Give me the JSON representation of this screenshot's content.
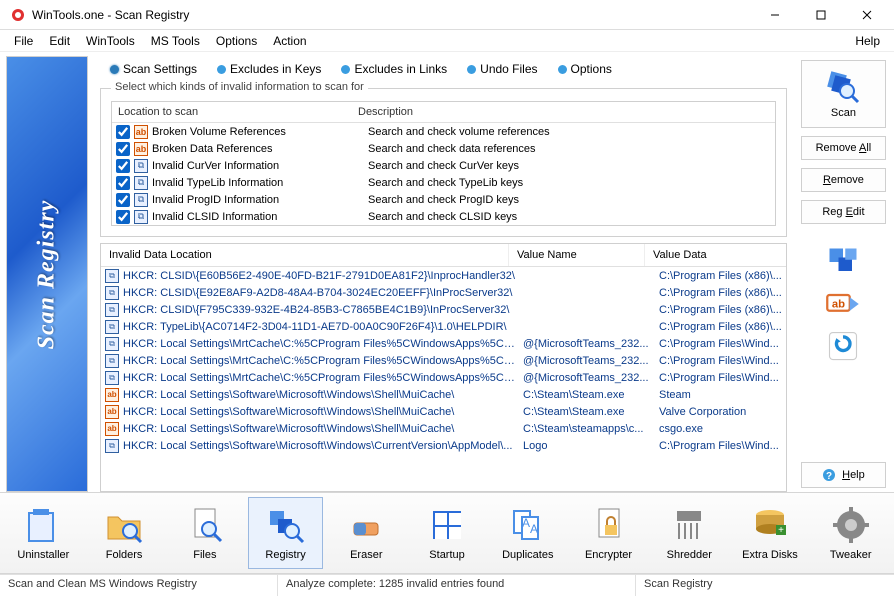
{
  "window": {
    "title": "WinTools.one - Scan Registry"
  },
  "menubar": {
    "items": [
      "File",
      "Edit",
      "WinTools",
      "MS Tools",
      "Options",
      "Action"
    ],
    "help": "Help"
  },
  "banner": {
    "text": "Scan Registry"
  },
  "tabs": {
    "items": [
      "Scan Settings",
      "Excludes in Keys",
      "Excludes in Links",
      "Undo Files",
      "Options"
    ],
    "active": 0
  },
  "groupbox": {
    "title": "Select which kinds of invalid information to scan for"
  },
  "kinds": {
    "headers": {
      "location": "Location to scan",
      "description": "Description"
    },
    "items": [
      {
        "checked": true,
        "icon": "ab",
        "location": "Broken Volume References",
        "description": "Search and check volume references"
      },
      {
        "checked": true,
        "icon": "ab",
        "location": "Broken Data References",
        "description": "Search and check data references"
      },
      {
        "checked": true,
        "icon": "reg",
        "location": "Invalid CurVer Information",
        "description": "Search and check CurVer keys"
      },
      {
        "checked": true,
        "icon": "reg",
        "location": "Invalid TypeLib Information",
        "description": "Search and check TypeLib keys"
      },
      {
        "checked": true,
        "icon": "reg",
        "location": "Invalid ProgID Information",
        "description": "Search and check ProgID keys"
      },
      {
        "checked": true,
        "icon": "reg",
        "location": "Invalid CLSID Information",
        "description": "Search and check CLSID keys"
      }
    ]
  },
  "results": {
    "headers": {
      "location": "Invalid Data Location",
      "valuename": "Value Name",
      "valuedata": "Value Data"
    },
    "rows": [
      {
        "icon": "reg",
        "location": "HKCR: CLSID\\{E60B56E2-490E-40FD-B21F-2791D0EA81F2}\\InprocHandler32\\",
        "valuename": "",
        "valuedata": "C:\\Program Files (x86)\\..."
      },
      {
        "icon": "reg",
        "location": "HKCR: CLSID\\{E92E8AF9-A2D8-48A4-B704-3024EC20EEFF}\\InProcServer32\\",
        "valuename": "",
        "valuedata": "C:\\Program Files (x86)\\..."
      },
      {
        "icon": "reg",
        "location": "HKCR: CLSID\\{F795C339-932E-4B24-85B3-C7865BE4C1B9}\\InProcServer32\\",
        "valuename": "",
        "valuedata": "C:\\Program Files (x86)\\..."
      },
      {
        "icon": "reg",
        "location": "HKCR: TypeLib\\{AC0714F2-3D04-11D1-AE7D-00A0C90F26F4}\\1.0\\HELPDIR\\",
        "valuename": "",
        "valuedata": "C:\\Program Files (x86)\\..."
      },
      {
        "icon": "reg",
        "location": "HKCR: Local Settings\\MrtCache\\C:%5CProgram Files%5CWindowsApps%5CMi...",
        "valuename": "@{MicrosoftTeams_232...",
        "valuedata": "C:\\Program Files\\Wind..."
      },
      {
        "icon": "reg",
        "location": "HKCR: Local Settings\\MrtCache\\C:%5CProgram Files%5CWindowsApps%5CMi...",
        "valuename": "@{MicrosoftTeams_232...",
        "valuedata": "C:\\Program Files\\Wind..."
      },
      {
        "icon": "reg",
        "location": "HKCR: Local Settings\\MrtCache\\C:%5CProgram Files%5CWindowsApps%5CMi...",
        "valuename": "@{MicrosoftTeams_232...",
        "valuedata": "C:\\Program Files\\Wind..."
      },
      {
        "icon": "ab",
        "location": "HKCR: Local Settings\\Software\\Microsoft\\Windows\\Shell\\MuiCache\\",
        "valuename": "C:\\Steam\\Steam.exe",
        "valuedata": "Steam"
      },
      {
        "icon": "ab",
        "location": "HKCR: Local Settings\\Software\\Microsoft\\Windows\\Shell\\MuiCache\\",
        "valuename": "C:\\Steam\\Steam.exe",
        "valuedata": "Valve Corporation"
      },
      {
        "icon": "ab",
        "location": "HKCR: Local Settings\\Software\\Microsoft\\Windows\\Shell\\MuiCache\\",
        "valuename": "C:\\Steam\\steamapps\\c...",
        "valuedata": "csgo.exe"
      },
      {
        "icon": "reg",
        "location": "HKCR: Local Settings\\Software\\Microsoft\\Windows\\CurrentVersion\\AppModel\\...",
        "valuename": "Logo",
        "valuedata": "C:\\Program Files\\Wind..."
      }
    ]
  },
  "right": {
    "scan": "Scan",
    "remove_all": "Remove All",
    "remove": "Remove",
    "reg_edit": "Reg Edit",
    "help": "Help"
  },
  "tools": {
    "items": [
      "Uninstaller",
      "Folders",
      "Files",
      "Registry",
      "Eraser",
      "Startup",
      "Duplicates",
      "Encrypter",
      "Shredder",
      "Extra Disks",
      "Tweaker"
    ],
    "active": 3
  },
  "status": {
    "s1": "Scan and Clean MS Windows Registry",
    "s2": "Analyze complete: 1285 invalid entries found",
    "s3": "Scan Registry"
  }
}
